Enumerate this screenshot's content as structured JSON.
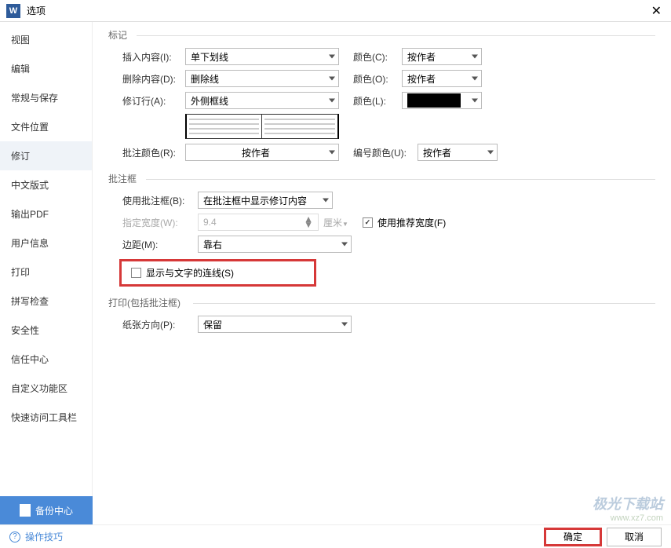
{
  "window": {
    "title": "选项"
  },
  "sidebar": {
    "items": [
      {
        "label": "视图"
      },
      {
        "label": "编辑"
      },
      {
        "label": "常规与保存"
      },
      {
        "label": "文件位置"
      },
      {
        "label": "修订"
      },
      {
        "label": "中文版式"
      },
      {
        "label": "输出PDF"
      },
      {
        "label": "用户信息"
      },
      {
        "label": "打印"
      },
      {
        "label": "拼写检查"
      },
      {
        "label": "安全性"
      },
      {
        "label": "信任中心"
      },
      {
        "label": "自定义功能区"
      },
      {
        "label": "快速访问工具栏"
      }
    ]
  },
  "markGroup": {
    "title": "标记",
    "insertLabel": "插入内容(I):",
    "insertValue": "单下划线",
    "colorC": "颜色(C):",
    "colorCValue": "按作者",
    "deleteLabel": "删除内容(D):",
    "deleteValue": "删除线",
    "colorO": "颜色(O):",
    "colorOValue": "按作者",
    "revLineLabel": "修订行(A):",
    "revLineValue": "外侧框线",
    "colorL": "颜色(L):",
    "commentColorLabel": "批注颜色(R):",
    "commentColorValue": "按作者",
    "numColorLabel": "编号颜色(U):",
    "numColorValue": "按作者"
  },
  "balloonGroup": {
    "title": "批注框",
    "useBalloonLabel": "使用批注框(B):",
    "useBalloonValue": "在批注框中显示修订内容",
    "widthLabel": "指定宽度(W):",
    "widthValue": "9.4",
    "widthUnit": "厘米",
    "recommendWidth": "使用推荐宽度(F)",
    "marginLabel": "边距(M):",
    "marginValue": "靠右",
    "showLine": "显示与文字的连线(S)"
  },
  "printGroup": {
    "title": "打印(包括批注框)",
    "paperDirLabel": "纸张方向(P):",
    "paperDirValue": "保留"
  },
  "footer": {
    "backup": "备份中心",
    "tips": "操作技巧",
    "ok": "确定",
    "cancel": "取消"
  },
  "watermark": {
    "line1": "极光下载站",
    "line2": "www.xz7.com"
  }
}
